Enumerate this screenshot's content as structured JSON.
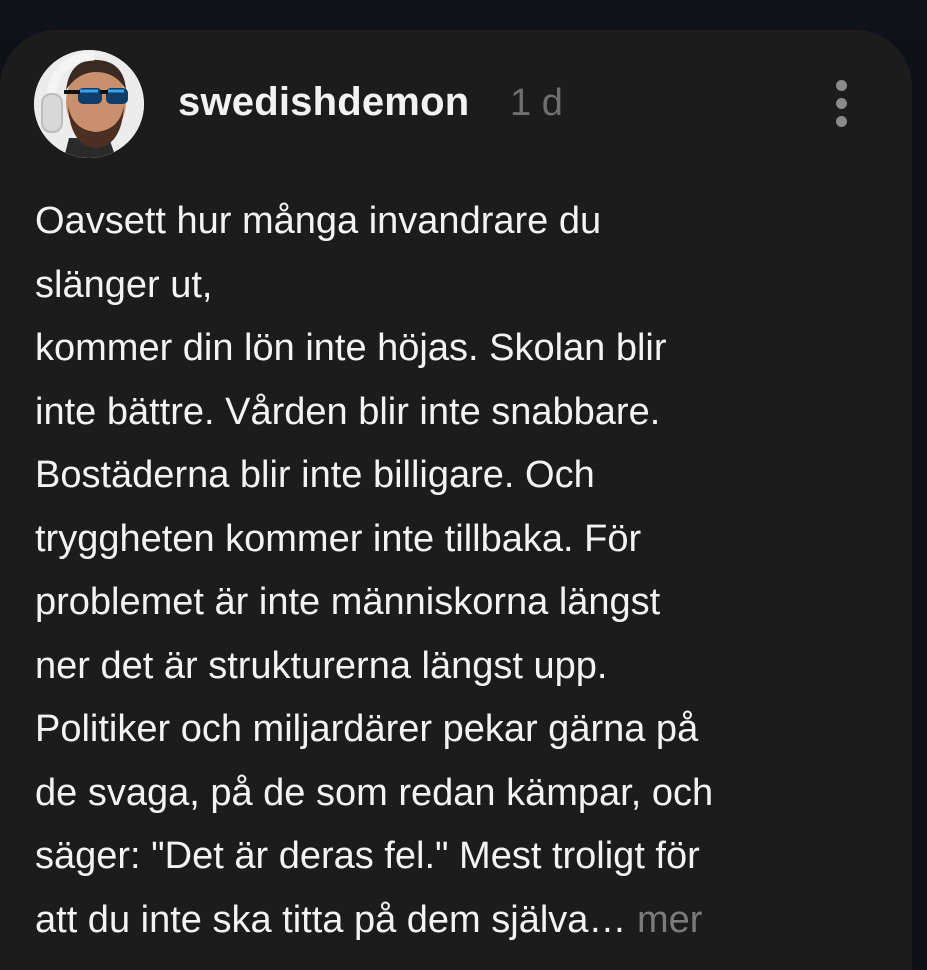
{
  "post": {
    "username": "swedishdemon",
    "time": "1 d",
    "lines": [
      "Oavsett hur många invandrare du",
      "slänger ut,",
      "kommer din lön inte höjas. Skolan blir",
      "inte bättre. Vården blir inte snabbare.",
      "Bostäderna blir inte billigare. Och",
      "tryggheten kommer inte tillbaka. För",
      "problemet är inte människorna längst",
      "ner det är strukturerna längst upp.",
      "Politiker och miljardärer pekar gärna på",
      "de svaga, på de som redan kämpar, och",
      "säger: \"Det är deras fel.\" Mest troligt för",
      "att du inte ska titta på dem själva…"
    ],
    "more_label": "mer"
  },
  "colors": {
    "page_background": "#0d1117",
    "card_background": "#1c1c1d",
    "text": "#f3f3f3",
    "muted": "#6f6f72"
  },
  "icons": {
    "avatar": "avatar",
    "menu": "more-vertical-icon"
  }
}
